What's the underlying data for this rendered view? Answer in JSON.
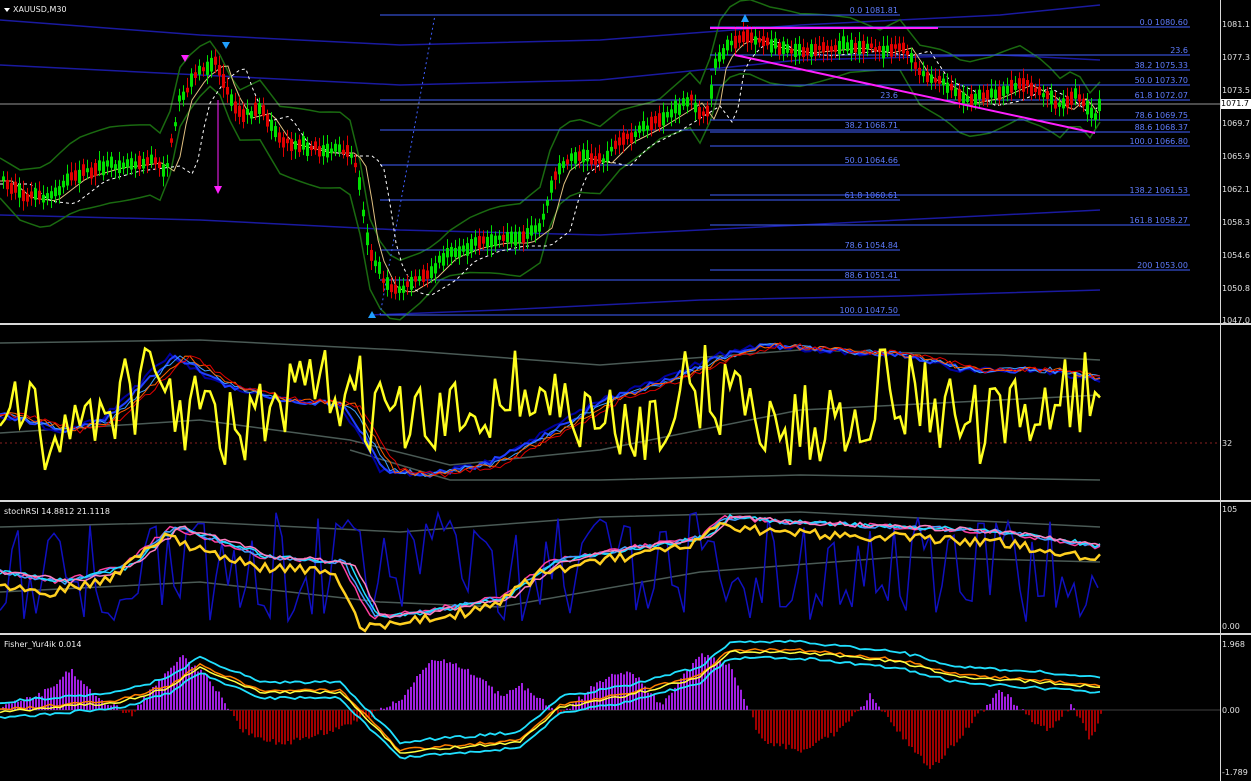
{
  "window": {
    "title": "XAUUSD,M30"
  },
  "main_axis": {
    "ticks": [
      "1081.1",
      "1077.3",
      "1073.5",
      "1069.7",
      "1065.9",
      "1062.1",
      "1058.3",
      "1054.6",
      "1050.8",
      "1047.0"
    ],
    "last_price": "1071.7"
  },
  "fib_left": [
    "0.0 1081.81",
    "23.6",
    "38.2 1068.71",
    "50.0 1064.66",
    "61.8 1060.61",
    "78.6 1054.84",
    "88.6 1051.41",
    "100.0 1047.50"
  ],
  "fib_right": [
    "0.0 1080.60",
    "23.6",
    "38.2 1075.33",
    "50.0 1073.70",
    "61.8 1072.07",
    "78.6 1069.75",
    "88.6 1068.37",
    "100.0 1066.80",
    "138.2 1061.53",
    "161.8 1058.27",
    "200 1053.00"
  ],
  "pane2": {
    "tick": "32"
  },
  "pane3": {
    "title": "stochRSI 14.8812 21.1118",
    "ticks": [
      "105",
      "0.00"
    ]
  },
  "pane4": {
    "title": "Fisher_Yur4ik 0.014",
    "ticks": [
      "1.968",
      "0.00",
      "-1.789"
    ]
  },
  "colors": {
    "bull": "#00e000",
    "bear": "#e00000",
    "yellow": "#ffff20",
    "fib": "#3f5fff",
    "magenta": "#ff20ff",
    "cyan": "#20e0ff",
    "purple": "#a020e0",
    "maroon": "#a00000",
    "band_green": "#1a6a10",
    "band_blue": "#1a1aa0"
  }
}
